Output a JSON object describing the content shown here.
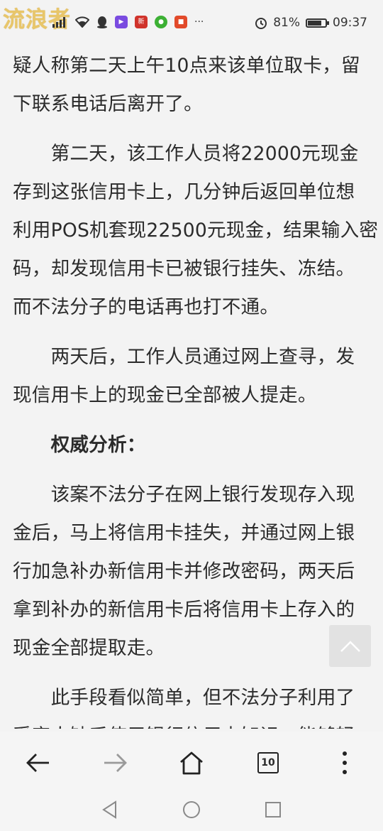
{
  "status_bar": {
    "watermark": "流浪者",
    "notification_icons": [
      "hd-icon",
      "signal-icon",
      "wifi-icon",
      "qq-icon",
      "video-app-icon",
      "news-app-icon",
      "wechat-icon",
      "app-icon",
      "more-icon"
    ],
    "more_label": "···",
    "battery_percent": "81%",
    "battery_level": 0.81,
    "time": "09:37"
  },
  "article": {
    "paragraphs": [
      {
        "lines": [
          "疑人称第二天上午10点来该单位取卡，留",
          "下联系电话后离开了。"
        ]
      },
      {
        "lines": [
          "　　第二天，该工作人员将22000元现金",
          "存到这张信用卡上，几分钟后返回单位想",
          "利用POS机套现22500元现金，结果输入密",
          "码，却发现信用卡已被银行挂失、冻结。",
          "而不法分子的电话再也打不通。"
        ]
      },
      {
        "lines": [
          "　　两天后，工作人员通过网上查寻，发",
          "现信用卡上的现金已全部被人提走。"
        ]
      },
      {
        "lines": [
          "　　权威分析："
        ],
        "heading": true
      },
      {
        "lines": [
          "　　该案不法分子在网上银行发现存入现",
          "金后，马上将信用卡挂失，并通过网上银",
          "行加急补办新信用卡并修改密码，两天后",
          "拿到补办的新信用卡后将信用卡上存入的",
          "现金全部提取走。"
        ]
      },
      {
        "lines": [
          "　　此手段看似简单，但不法分子利用了",
          "受害人缺乏使用银行信用卡知识，能够轻"
        ]
      }
    ]
  },
  "toolbar": {
    "tabs_count": "10"
  },
  "colors": {
    "background": "#f3f3f3",
    "text": "#2b2b2b",
    "watermark": "#e8c66a",
    "disabled_icon": "#9a9a9a"
  }
}
